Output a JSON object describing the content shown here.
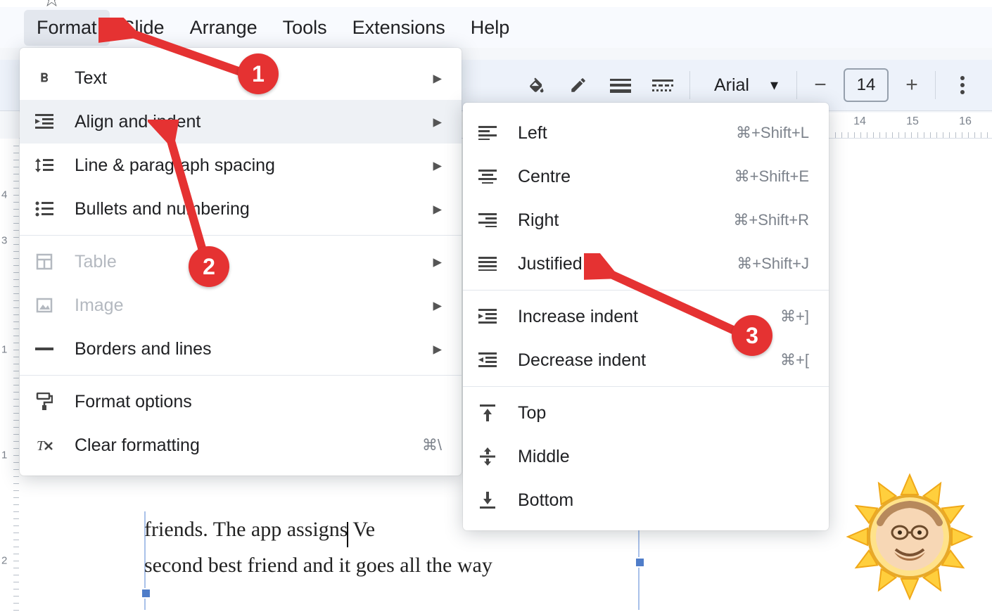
{
  "menubar": {
    "items": [
      "Format",
      "Slide",
      "Arrange",
      "Tools",
      "Extensions",
      "Help"
    ],
    "active_index": 0
  },
  "toolbar": {
    "font_name": "Arial",
    "font_size": "14"
  },
  "format_menu": {
    "items": [
      {
        "icon": "bold-icon",
        "label": "Text",
        "submenu": true
      },
      {
        "icon": "indent-icon",
        "label": "Align and indent",
        "submenu": true,
        "hover": true
      },
      {
        "icon": "linesp-icon",
        "label": "Line & paragraph spacing",
        "submenu": true
      },
      {
        "icon": "list-icon",
        "label": "Bullets and numbering",
        "submenu": true
      },
      {
        "sep": true
      },
      {
        "icon": "table-icon",
        "label": "Table",
        "submenu": true,
        "disabled": true
      },
      {
        "icon": "image-icon",
        "label": "Image",
        "submenu": true,
        "disabled": true
      },
      {
        "icon": "line-icon",
        "label": "Borders and lines",
        "submenu": true
      },
      {
        "sep": true
      },
      {
        "icon": "roller-icon",
        "label": "Format options"
      },
      {
        "icon": "clearfmt-icon",
        "label": "Clear formatting",
        "shortcut": "⌘\\"
      }
    ]
  },
  "align_menu": {
    "items": [
      {
        "icon": "align-left-icon",
        "label": "Left",
        "shortcut": "⌘+Shift+L"
      },
      {
        "icon": "align-center-icon",
        "label": "Centre",
        "shortcut": "⌘+Shift+E"
      },
      {
        "icon": "align-right-icon",
        "label": "Right",
        "shortcut": "⌘+Shift+R"
      },
      {
        "icon": "align-justify-icon",
        "label": "Justified",
        "shortcut": "⌘+Shift+J"
      },
      {
        "sep": true
      },
      {
        "icon": "indent-inc-icon",
        "label": "Increase indent",
        "shortcut": "⌘+]"
      },
      {
        "icon": "indent-dec-icon",
        "label": "Decrease indent",
        "shortcut": "⌘+["
      },
      {
        "sep": true
      },
      {
        "icon": "valign-top-icon",
        "label": "Top"
      },
      {
        "icon": "valign-mid-icon",
        "label": "Middle"
      },
      {
        "icon": "valign-bot-icon",
        "label": "Bottom"
      }
    ]
  },
  "annotations": {
    "a1": "1",
    "a2": "2",
    "a3": "3"
  },
  "ruler_h_visible": [
    "14",
    "15",
    "16"
  ],
  "ruler_v_visible": [
    "1",
    "2",
    "3",
    "4"
  ],
  "slide": {
    "text_line1": "friends. The app assigns Ve",
    "text_line2": "second best friend and it goes all the way"
  }
}
